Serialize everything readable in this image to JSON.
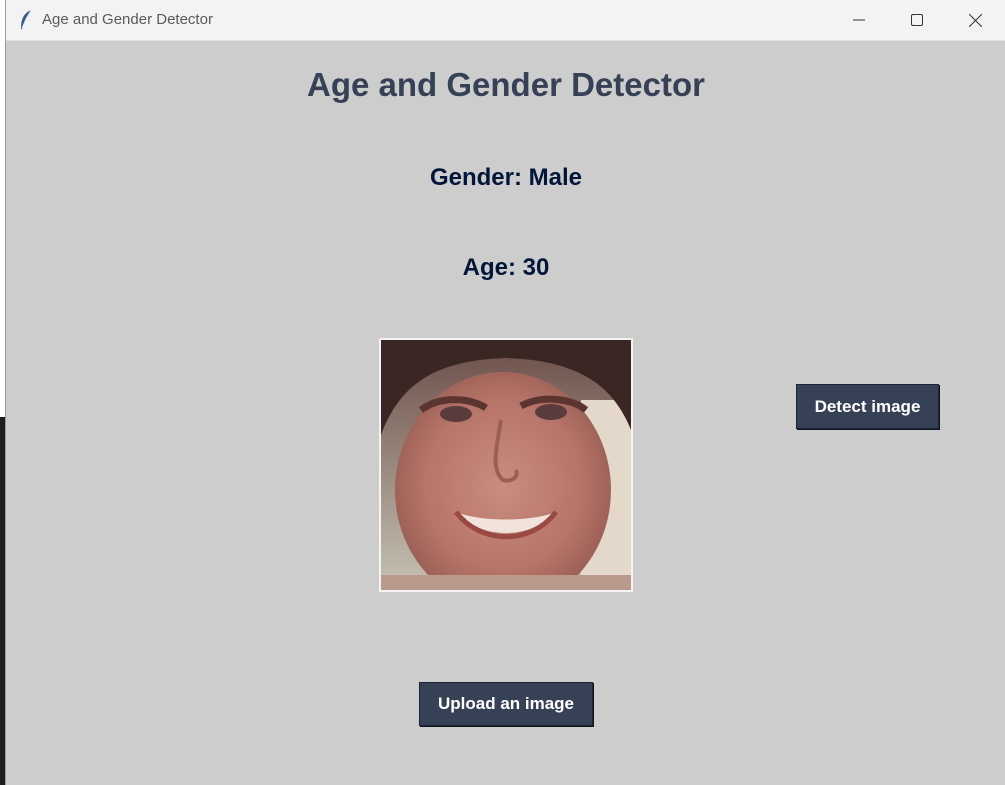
{
  "window": {
    "title": "Age and Gender Detector"
  },
  "main": {
    "heading": "Age and Gender Detector",
    "gender_text": "Gender: Male",
    "age_text": "Age: 30"
  },
  "buttons": {
    "detect_label": "Detect image",
    "upload_label": "Upload an image"
  },
  "icons": {
    "app": "feather-icon",
    "minimize": "minimize-icon",
    "maximize": "maximize-icon",
    "close": "close-icon"
  },
  "colors": {
    "background": "#cdcdcd",
    "heading": "#364156",
    "label": "#011638",
    "button": "#364156",
    "button_text": "#ffffff"
  }
}
